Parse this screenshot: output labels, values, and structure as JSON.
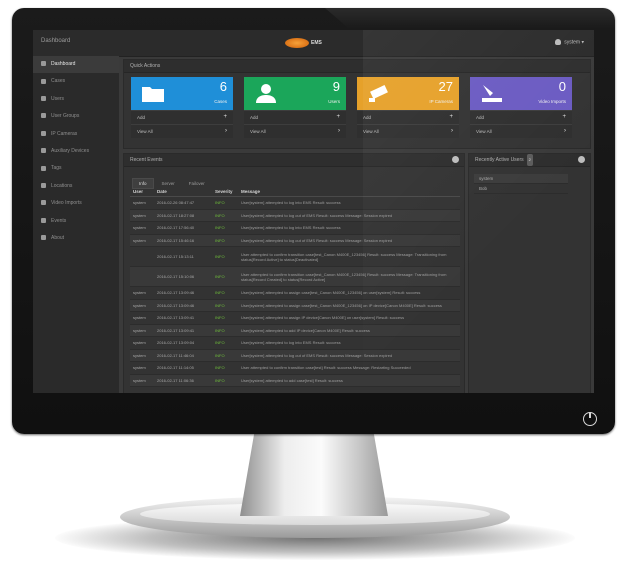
{
  "header": {
    "title": "Dashboard",
    "logo_text": "EMS",
    "user": "system"
  },
  "sidebar": {
    "items": [
      {
        "label": "Dashboard",
        "icon": "dashboard-icon",
        "active": true
      },
      {
        "label": "Cases",
        "icon": "folder-icon"
      },
      {
        "label": "Users",
        "icon": "user-icon"
      },
      {
        "label": "User Groups",
        "icon": "users-icon"
      },
      {
        "label": "IP Cameras",
        "icon": "camera-icon"
      },
      {
        "label": "Auxiliary Devices",
        "icon": "device-icon"
      },
      {
        "label": "Tags",
        "icon": "tag-icon"
      },
      {
        "label": "Locations",
        "icon": "location-icon"
      },
      {
        "label": "Video Imports",
        "icon": "import-icon"
      },
      {
        "label": "Events",
        "icon": "list-icon"
      },
      {
        "label": "About",
        "icon": "info-icon"
      }
    ]
  },
  "quick_actions": {
    "title": "Quick Actions",
    "tiles": [
      {
        "count": "6",
        "label": "Cases",
        "color": "#1f8fd8",
        "add": "Add",
        "view": "View All"
      },
      {
        "count": "9",
        "label": "Users",
        "color": "#1ba65a",
        "add": "Add",
        "view": "View All"
      },
      {
        "count": "27",
        "label": "IP Cameras",
        "color": "#e6a12a",
        "add": "Add",
        "view": "View All"
      },
      {
        "count": "0",
        "label": "Video Imports",
        "color": "#6b5bc2",
        "add": "Add",
        "view": "View All"
      }
    ]
  },
  "recent_events": {
    "title": "Recent Events",
    "tabs": [
      "Info",
      "Server",
      "Failover"
    ],
    "columns": [
      "User",
      "Date",
      "Severity",
      "Message"
    ],
    "rows": [
      {
        "user": "system",
        "date": "2016-02-26 08:47:47",
        "sev": "INFO",
        "msg": "User[system] attempted to log into EMS Result: success"
      },
      {
        "user": "system",
        "date": "2016-02-17 18:27:08",
        "sev": "INFO",
        "msg": "User[system] attempted to log out of EMS Result: success Message: Session expired"
      },
      {
        "user": "system",
        "date": "2016-02-17 17:56:40",
        "sev": "INFO",
        "msg": "User[system] attempted to log into EMS Result: success"
      },
      {
        "user": "system",
        "date": "2016-02-17 15:46:16",
        "sev": "INFO",
        "msg": "User[system] attempted to log out of EMS Result: success Message: Session expired"
      },
      {
        "user": "",
        "date": "2016-02-17 15:13:11",
        "sev": "INFO",
        "msg": "User attempted to confirm transition case[test_Canon M400E_123456] Result: success Message: Transitioning from status[Record Active] to status[Deactivated]",
        "tall": true
      },
      {
        "user": "",
        "date": "2016-02-17 15:10:06",
        "sev": "INFO",
        "msg": "User attempted to confirm transition case[test_Canon M400E_123456] Result: success Message: Transitioning from status[Record Created] to status[Record Active]",
        "tall": true
      },
      {
        "user": "system",
        "date": "2016-02-17 13:09:46",
        "sev": "INFO",
        "msg": "User[system] attempted to assign case[test_Canon M400E_123456] on user[system] Result: success"
      },
      {
        "user": "system",
        "date": "2016-02-17 13:09:46",
        "sev": "INFO",
        "msg": "User[system] attempted to assign case[test_Canon M400E_123456] on IP device[Canon M400E] Result: success"
      },
      {
        "user": "system",
        "date": "2016-02-17 13:09:41",
        "sev": "INFO",
        "msg": "User[system] attempted to assign IP device[Canon M400E] on user[system] Result: success"
      },
      {
        "user": "system",
        "date": "2016-02-17 13:09:41",
        "sev": "INFO",
        "msg": "User[system] attempted to add IP device[Canon M400E] Result: success"
      },
      {
        "user": "system",
        "date": "2016-02-17 13:09:04",
        "sev": "INFO",
        "msg": "User[system] attempted to log into EMS Result: success"
      },
      {
        "user": "system",
        "date": "2016-02-17 11:46:04",
        "sev": "INFO",
        "msg": "User[system] attempted to log out of EMS Result: success Message: Session expired"
      },
      {
        "user": "system",
        "date": "2016-02-17 11:14:05",
        "sev": "INFO",
        "msg": "User attempted to confirm transition case[test] Result: success Message: Restarting Succeeded"
      },
      {
        "user": "system",
        "date": "2016-02-17 11:06:36",
        "sev": "INFO",
        "msg": "User[system] attempted to add case[test] Result: success"
      }
    ]
  },
  "recent_users": {
    "title": "Recently Active Users",
    "count": "2",
    "users": [
      "system",
      "Bob"
    ]
  }
}
